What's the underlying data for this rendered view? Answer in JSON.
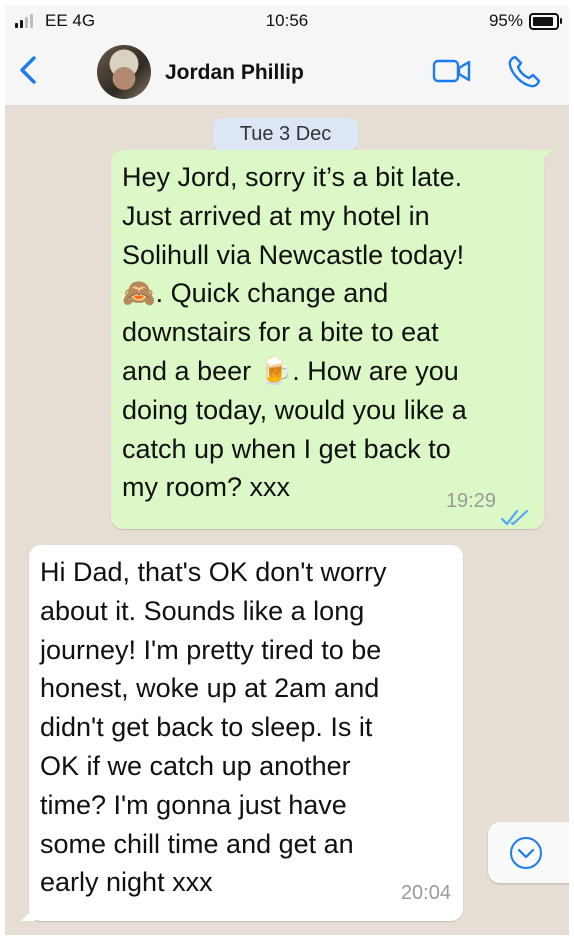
{
  "status_bar": {
    "carrier": "EE 4G",
    "time": "10:56",
    "battery": "95%"
  },
  "header": {
    "contact_name": "Jordan Phillip"
  },
  "chat": {
    "date_label": "Tue 3 Dec",
    "messages": [
      {
        "direction": "outgoing",
        "text": "Hey Jord, sorry it’s a bit late.\nJust arrived at my hotel in\nSolihull via Newcastle today!\n🙈. Quick change and\ndownstairs for a bite to eat\nand a beer 🍺. How are you\ndoing today, would you like a\ncatch up when I get back to\nmy room? xxx",
        "time": "19:29",
        "status": "read"
      },
      {
        "direction": "incoming",
        "text": "Hi Dad, that's OK don't worry\nabout it. Sounds like a long\njourney! I'm pretty tired to be\nhonest, woke up at 2am and\ndidn't get back to sleep. Is it\nOK if we catch up another\ntime? I'm gonna just have\nsome chill time and get an\nearly night xxx",
        "time": "20:04"
      }
    ]
  },
  "colors": {
    "accent": "#1a7bf2",
    "outgoing_bubble": "#dcf8c6",
    "incoming_bubble": "#ffffff",
    "chat_background": "#e6ddd4",
    "read_ticks": "#4fa8f0"
  },
  "icons": [
    "back-chevron-icon",
    "avatar",
    "video-call-icon",
    "phone-call-icon",
    "double-check-icon",
    "chevron-down-icon",
    "signal-icon",
    "battery-icon"
  ]
}
